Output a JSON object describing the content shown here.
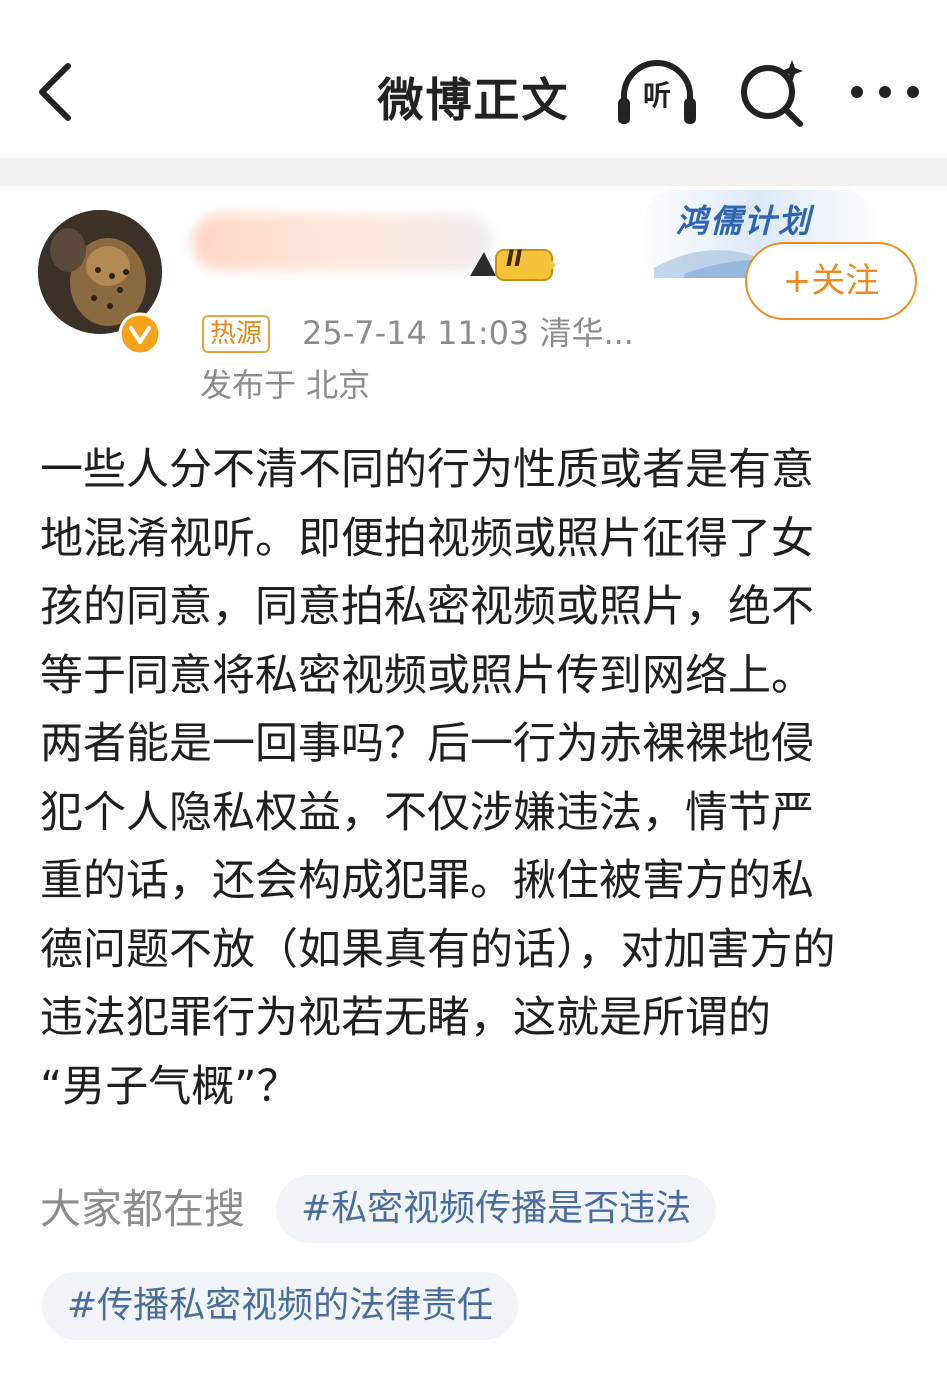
{
  "header": {
    "title": "微博正文",
    "listen_label": "听"
  },
  "author": {
    "level_badge": "II",
    "banner_text": "鸿儒计划",
    "follow_label": "+关注"
  },
  "post": {
    "hot_tag": "热源",
    "meta": "25-7-14 11:03  清华...",
    "location": "发布于 北京",
    "lines": [
      "一些人分不清不同的行为性质或者是有意",
      "地混淆视听。即便拍视频或照片征得了女",
      "孩的同意，同意拍私密视频或照片，绝不",
      "等于同意将私密视频或照片传到网络上。",
      "两者能是一回事吗？后一行为赤裸裸地侵",
      "犯个人隐私权益，不仅涉嫌违法，情节严",
      "重的话，还会构成犯罪。揪住被害方的私",
      "德问题不放（如果真有的话），对加害方的",
      "违法犯罪行为视若无睹，这就是所谓的",
      "“男子气概”？"
    ]
  },
  "search": {
    "label": "大家都在搜",
    "tags": [
      "#私密视频传播是否违法",
      "#传播私密视频的法律责任"
    ]
  },
  "colors": {
    "accent": "#f08a23",
    "tag_text": "#4b6d9d",
    "meta_gray": "#8c8c8c"
  }
}
